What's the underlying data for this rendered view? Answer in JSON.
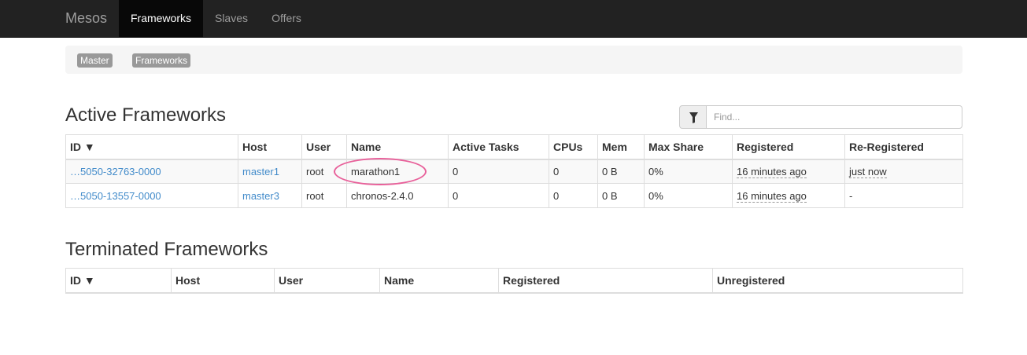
{
  "navbar": {
    "brand": "Mesos",
    "items": [
      "Frameworks",
      "Slaves",
      "Offers"
    ]
  },
  "breadcrumb": {
    "items": [
      "Master",
      "Frameworks"
    ],
    "separator": "/"
  },
  "active": {
    "title": "Active Frameworks",
    "filter_placeholder": "Find...",
    "columns": [
      "ID ▼",
      "Host",
      "User",
      "Name",
      "Active Tasks",
      "CPUs",
      "Mem",
      "Max Share",
      "Registered",
      "Re-Registered"
    ],
    "rows": [
      {
        "id": "…5050-32763-0000",
        "host": "master1",
        "user": "root",
        "name": "marathon1",
        "active_tasks": "0",
        "cpus": "0",
        "mem": "0 B",
        "max_share": "0%",
        "registered": "16 minutes ago",
        "reregistered": "just now"
      },
      {
        "id": "…5050-13557-0000",
        "host": "master3",
        "user": "root",
        "name": "chronos-2.4.0",
        "active_tasks": "0",
        "cpus": "0",
        "mem": "0 B",
        "max_share": "0%",
        "registered": "16 minutes ago",
        "reregistered": "-"
      }
    ]
  },
  "terminated": {
    "title": "Terminated Frameworks",
    "columns": [
      "ID ▼",
      "Host",
      "User",
      "Name",
      "Registered",
      "Unregistered"
    ]
  },
  "colors": {
    "navbar_bg": "#222222",
    "link": "#428bca",
    "highlight": "#e8609a"
  }
}
